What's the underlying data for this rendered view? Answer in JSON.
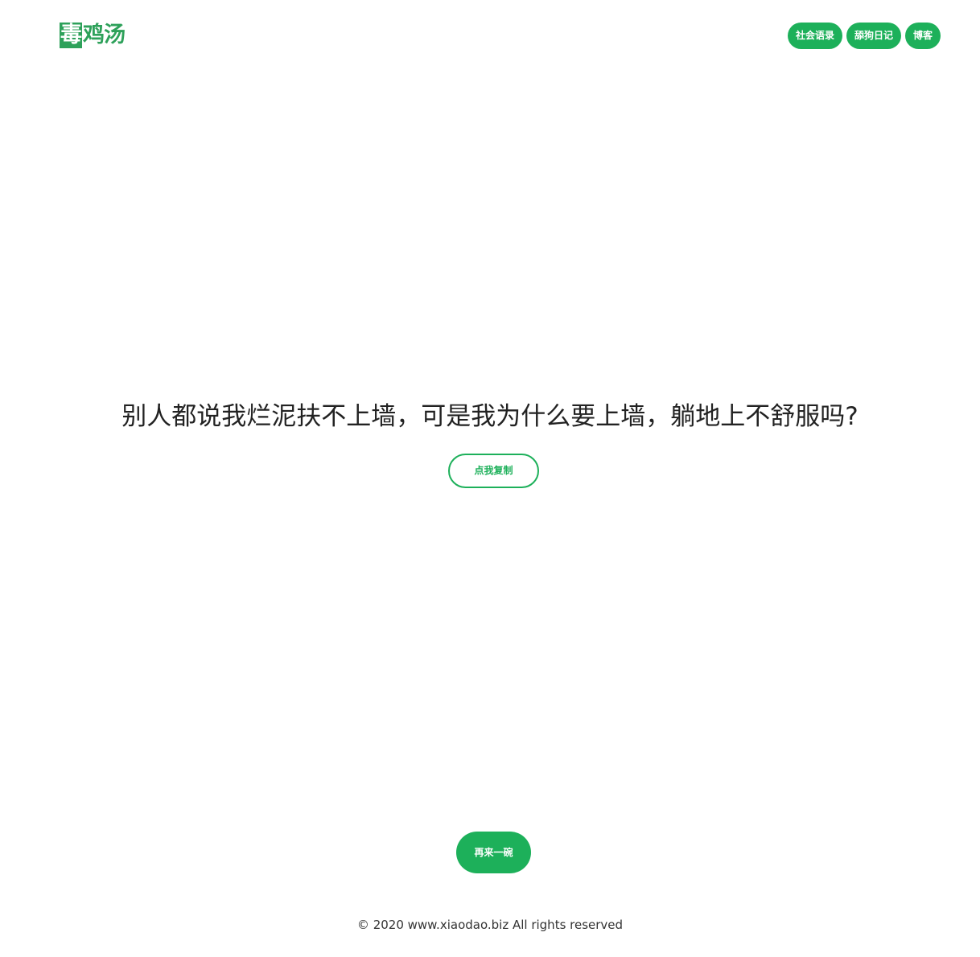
{
  "header": {
    "logo": {
      "first_char": "毒",
      "rest": "鸡汤"
    },
    "nav": [
      {
        "label": "社会语录"
      },
      {
        "label": "舔狗日记"
      },
      {
        "label": "博客"
      }
    ]
  },
  "main": {
    "quote": "别人都说我烂泥扶不上墙，可是我为什么要上墙，躺地上不舒服吗?",
    "copy_button": "点我复制",
    "again_button": "再来一碗"
  },
  "footer": {
    "copyright": "© 2020 www.xiaodao.biz All rights reserved"
  },
  "colors": {
    "accent": "#1db05a",
    "logo": "#2ea15a",
    "text": "#222222"
  }
}
